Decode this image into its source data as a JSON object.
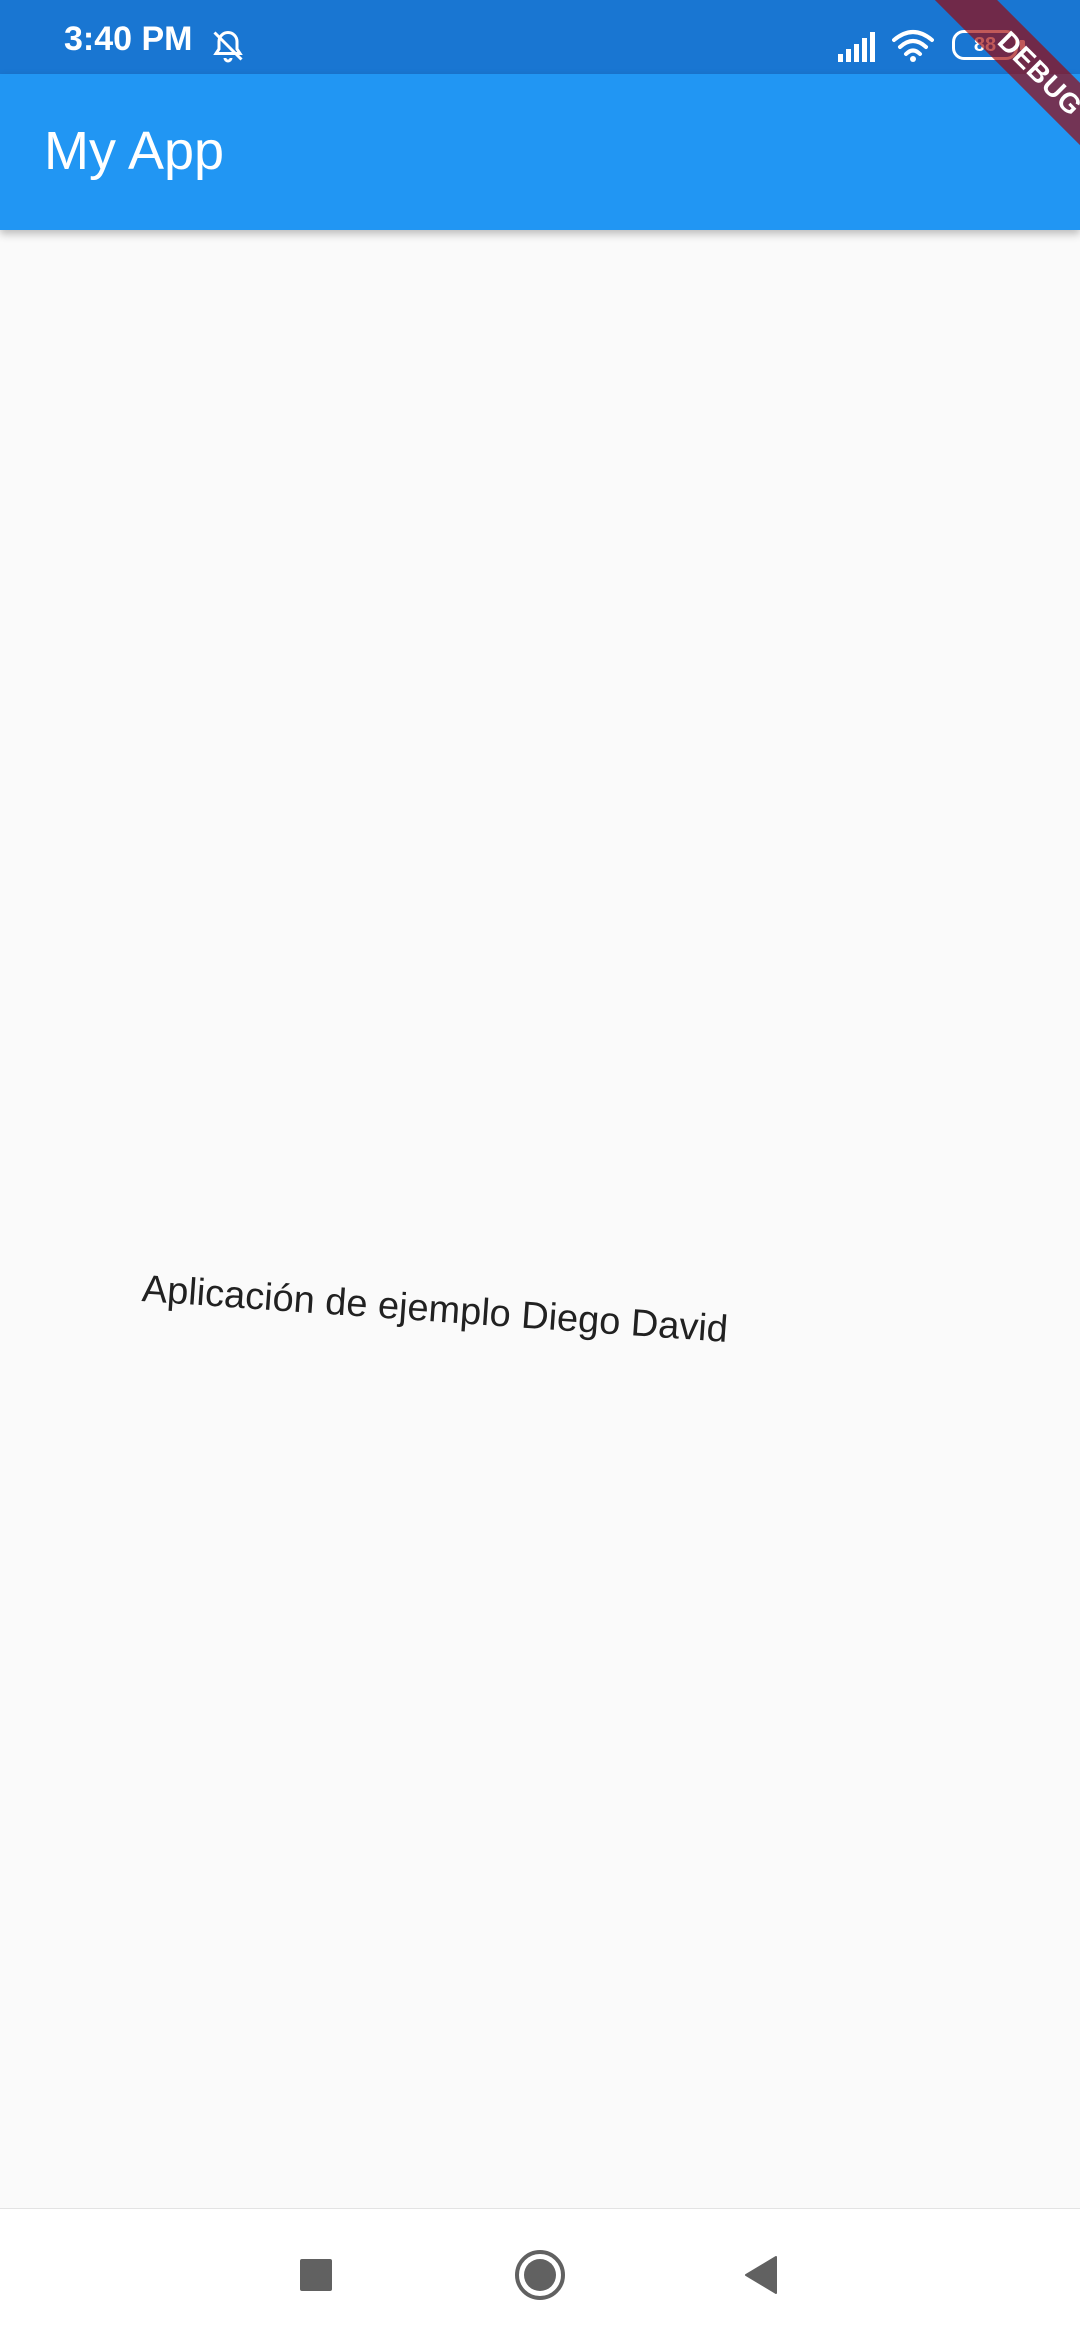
{
  "status_bar": {
    "time": "3:40 PM",
    "battery_level": "88",
    "icons": [
      "alarm-off-icon",
      "signal-icon",
      "wifi-icon",
      "battery-icon"
    ]
  },
  "app_bar": {
    "title": "My App"
  },
  "debug_banner": {
    "label": "DEBUG"
  },
  "main": {
    "text": "Aplicación de ejemplo Diego David"
  },
  "nav_bar": {
    "icons": [
      "recents-square-icon",
      "home-circle-icon",
      "back-triangle-icon"
    ]
  },
  "colors": {
    "status_bar": "#1976d2",
    "app_bar": "#2196f3",
    "background": "#fafafa",
    "debug_ribbon": "#a00000",
    "nav_icon": "#616161"
  }
}
